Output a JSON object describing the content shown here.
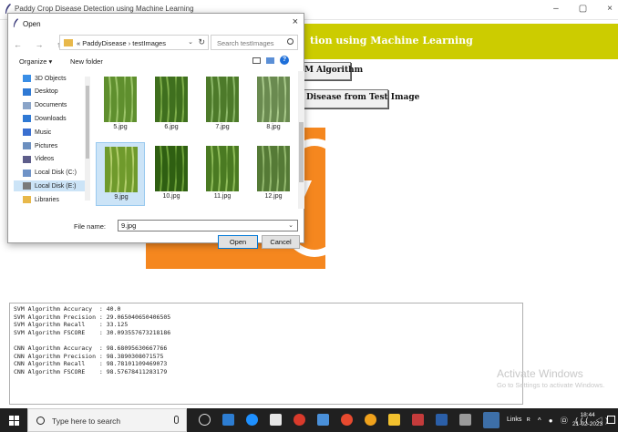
{
  "app": {
    "title": "Paddy Crop Disease Detection using Machine Learning",
    "minimize": "–",
    "maximize": "▢",
    "close": "×",
    "banner": "tion using Machine Learning"
  },
  "buttons": {
    "svm": "M Algorithm",
    "predict": "Disease from Test Image"
  },
  "results": {
    "lines": [
      "SVM Algorithm Accuracy  : 40.0",
      "SVM Algorithm Precision : 29.065040650406505",
      "SVM Algorithm Recall    : 33.125",
      "SVM Algorithm FSCORE    : 30.093557673218186",
      "",
      "CNN Algorithm Accuracy  : 98.68095630667766",
      "CNN Algorithm Precision : 98.3890308071575",
      "CNN Algorithm Recall    : 98.78101109469073",
      "CNN Algorithm FSCORE    : 98.57678411283179"
    ]
  },
  "watermark": {
    "line1": "Activate Windows",
    "line2": "Go to Settings to activate Windows."
  },
  "dialog": {
    "title": "Open",
    "close": "×",
    "nav": "← → ↑",
    "path": "« PaddyDisease › testImages",
    "path_chevron": "⌄",
    "refresh": "↻",
    "search_placeholder": "Search testImages",
    "organize": "Organize ▾",
    "new_folder": "New folder",
    "help": "?",
    "sidebar": [
      {
        "label": "3D Objects",
        "icon": "cube-icon",
        "color": "#3a8ee6"
      },
      {
        "label": "Desktop",
        "icon": "desktop-icon",
        "color": "#2f79d4"
      },
      {
        "label": "Documents",
        "icon": "documents-icon",
        "color": "#8aa4c8"
      },
      {
        "label": "Downloads",
        "icon": "download-icon",
        "color": "#2f79d4"
      },
      {
        "label": "Music",
        "icon": "music-icon",
        "color": "#3a6fd0"
      },
      {
        "label": "Pictures",
        "icon": "pictures-icon",
        "color": "#6c8fbf"
      },
      {
        "label": "Videos",
        "icon": "videos-icon",
        "color": "#5d5d8a"
      },
      {
        "label": "Local Disk (C:)",
        "icon": "drive-c-icon",
        "color": "#6f93c7"
      },
      {
        "label": "Local Disk (E:)",
        "icon": "drive-e-icon",
        "color": "#7a7a7a"
      },
      {
        "label": "Libraries",
        "icon": "libraries-icon",
        "color": "#e8b84a"
      }
    ],
    "files": [
      {
        "name": "5.jpg",
        "selected": false
      },
      {
        "name": "6.jpg",
        "selected": false
      },
      {
        "name": "7.jpg",
        "selected": false
      },
      {
        "name": "8.jpg",
        "selected": false
      },
      {
        "name": "9.jpg",
        "selected": true
      },
      {
        "name": "10.jpg",
        "selected": false
      },
      {
        "name": "11.jpg",
        "selected": false
      },
      {
        "name": "12.jpg",
        "selected": false
      }
    ],
    "filename_label": "File name:",
    "filename_value": "9.jpg",
    "open": "Open",
    "cancel": "Cancel"
  },
  "taskbar": {
    "search_placeholder": "Type here to search",
    "links": "Links",
    "tray": "ᴿ ^ ● ㉤ ((( ◁)",
    "time": "18:44",
    "date": "21-02-2023"
  }
}
